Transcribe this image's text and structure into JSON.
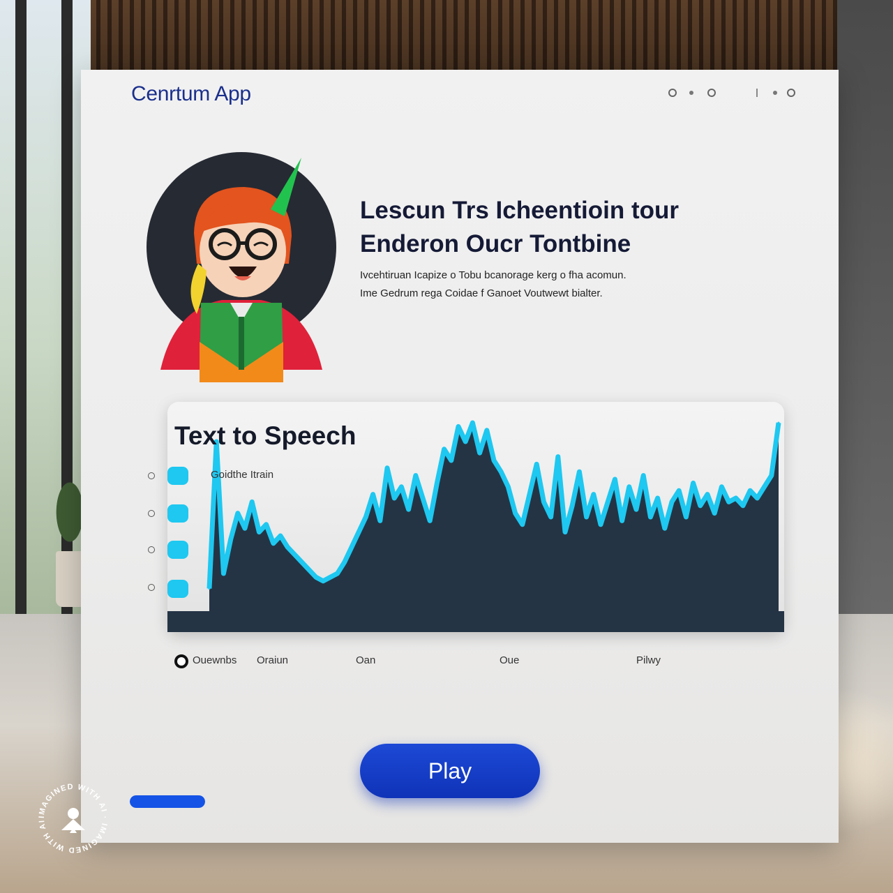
{
  "app": {
    "title": "Cenrtum App"
  },
  "headline": {
    "line1": "Lescun Trs Icheentioin tour",
    "line2": "Enderon Oucr Tontbine",
    "description_line1": "Ivcehtiruan Icapize o Tobu bcanorage kerg o fha acomun.",
    "description_line2": "Ime Gedrum rega Coidae f Ganoet Voutwewt bialter."
  },
  "tts": {
    "title": "Text to Speech",
    "voice_label": "Goidthe Itrain"
  },
  "tabs": [
    {
      "label": "Ouewnbs"
    },
    {
      "label": "Oraiun"
    },
    {
      "label": "Oan"
    },
    {
      "label": "Oue"
    },
    {
      "label": "Pilwy"
    }
  ],
  "play_button": {
    "label": "Play"
  },
  "progress": {
    "fraction": 1.0
  },
  "watermark": {
    "text": "IMAGINED WITH AI"
  },
  "colors": {
    "brand": "#1a2f8c",
    "accent": "#1d49d6",
    "wave": "#1ec8f0",
    "wave_fill": "#243445"
  },
  "icons": [
    "window-control-icon",
    "avatar-illustration"
  ],
  "chart_data": {
    "type": "area",
    "title": "",
    "xlabel": "",
    "ylabel": "",
    "x": [
      0,
      1,
      2,
      3,
      4,
      5,
      6,
      7,
      8,
      9,
      10,
      11,
      12,
      13,
      14,
      15,
      16,
      17,
      18,
      19,
      20,
      21,
      22,
      23,
      24,
      25,
      26,
      27,
      28,
      29,
      30,
      31,
      32,
      33,
      34,
      35,
      36,
      37,
      38,
      39,
      40,
      41,
      42,
      43,
      44,
      45,
      46,
      47,
      48,
      49,
      50,
      51,
      52,
      53,
      54,
      55,
      56,
      57,
      58,
      59,
      60,
      61,
      62,
      63,
      64,
      65,
      66,
      67,
      68,
      69,
      70,
      71,
      72,
      73,
      74,
      75,
      76,
      77,
      78,
      79,
      80
    ],
    "values": [
      0.12,
      0.9,
      0.2,
      0.38,
      0.52,
      0.44,
      0.58,
      0.42,
      0.46,
      0.36,
      0.4,
      0.34,
      0.3,
      0.26,
      0.22,
      0.18,
      0.16,
      0.18,
      0.2,
      0.26,
      0.34,
      0.42,
      0.5,
      0.62,
      0.48,
      0.76,
      0.6,
      0.66,
      0.54,
      0.72,
      0.6,
      0.48,
      0.68,
      0.86,
      0.8,
      0.98,
      0.9,
      1.0,
      0.84,
      0.96,
      0.8,
      0.74,
      0.66,
      0.52,
      0.46,
      0.62,
      0.78,
      0.58,
      0.5,
      0.82,
      0.42,
      0.56,
      0.74,
      0.5,
      0.62,
      0.46,
      0.58,
      0.7,
      0.48,
      0.66,
      0.54,
      0.72,
      0.5,
      0.6,
      0.44,
      0.58,
      0.64,
      0.5,
      0.68,
      0.56,
      0.62,
      0.52,
      0.66,
      0.58,
      0.6,
      0.56,
      0.64,
      0.6,
      0.66,
      0.72,
      1.0
    ],
    "ylim": [
      0,
      1
    ],
    "grid": false,
    "legend": "none"
  }
}
